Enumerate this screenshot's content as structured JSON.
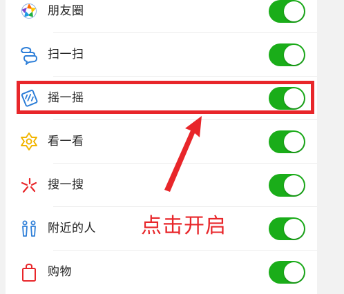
{
  "colors": {
    "toggle_on": "#1aad19",
    "annotation": "#e8262a",
    "divider": "#ececec",
    "background": "#f2f2f2"
  },
  "settings": {
    "items": [
      {
        "label": "朋友圈",
        "icon": "moments-icon",
        "enabled": true
      },
      {
        "label": "扫一扫",
        "icon": "scan-icon",
        "enabled": true
      },
      {
        "label": "摇一摇",
        "icon": "shake-icon",
        "enabled": true
      },
      {
        "label": "看一看",
        "icon": "top-stories-icon",
        "enabled": true
      },
      {
        "label": "搜一搜",
        "icon": "search-star-icon",
        "enabled": true
      },
      {
        "label": "附近的人",
        "icon": "people-nearby-icon",
        "enabled": true
      },
      {
        "label": "购物",
        "icon": "shopping-bag-icon",
        "enabled": true
      }
    ]
  },
  "annotation": {
    "text": "点击开启",
    "highlighted_item": "摇一摇"
  }
}
